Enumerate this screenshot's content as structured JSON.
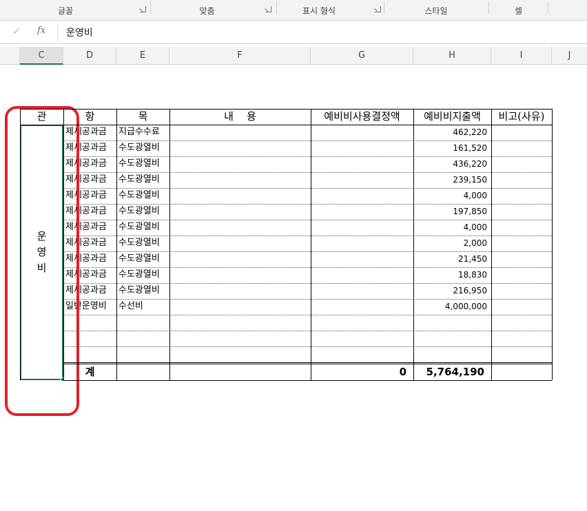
{
  "ribbon": {
    "groups": [
      {
        "label": "글꼴",
        "launcher": true
      },
      {
        "label": "맞춤",
        "launcher": true
      },
      {
        "label": "표시 형식",
        "launcher": true
      },
      {
        "label": "스타일",
        "launcher": false
      },
      {
        "label": "셀",
        "launcher": false
      }
    ]
  },
  "formula_bar": {
    "check_glyph": "✓",
    "fx_label": "fx",
    "value": "운영비"
  },
  "columns": [
    "C",
    "D",
    "E",
    "F",
    "G",
    "H",
    "I",
    "J"
  ],
  "selected_column": "C",
  "table": {
    "headers": {
      "gwan": "관",
      "hang": "항",
      "mok": "목",
      "naeyong": "내    용",
      "decision": "예비비사용결정액",
      "expense": "예비비지출액",
      "note": "비고(사유)"
    },
    "merged_cell_text": "운영비",
    "rows": [
      {
        "hang": "제세공과금",
        "mok": "지급수수료",
        "expense": "462,220"
      },
      {
        "hang": "제세공과금",
        "mok": "수도광열비",
        "expense": "161,520"
      },
      {
        "hang": "제세공과금",
        "mok": "수도광열비",
        "expense": "436,220"
      },
      {
        "hang": "제세공과금",
        "mok": "수도광열비",
        "expense": "239,150"
      },
      {
        "hang": "제세공과금",
        "mok": "수도광열비",
        "expense": "4,000"
      },
      {
        "hang": "제세공과금",
        "mok": "수도광열비",
        "expense": "197,850"
      },
      {
        "hang": "제세공과금",
        "mok": "수도광열비",
        "expense": "4,000"
      },
      {
        "hang": "제세공과금",
        "mok": "수도광열비",
        "expense": "2,000"
      },
      {
        "hang": "제세공과금",
        "mok": "수도광열비",
        "expense": "21,450"
      },
      {
        "hang": "제세공과금",
        "mok": "수도광열비",
        "expense": "18,830"
      },
      {
        "hang": "제세공과금",
        "mok": "수도광열비",
        "expense": "216,950"
      },
      {
        "hang": "일반운영비",
        "mok": "수선비",
        "expense": "4,000,000"
      },
      {
        "hang": "",
        "mok": "",
        "expense": ""
      },
      {
        "hang": "",
        "mok": "",
        "expense": ""
      },
      {
        "hang": "",
        "mok": "",
        "expense": ""
      }
    ],
    "total": {
      "label": "계",
      "decision": "0",
      "expense": "5,764,190"
    }
  },
  "colors": {
    "selection": "#217346",
    "annotation": "#e0212b"
  }
}
